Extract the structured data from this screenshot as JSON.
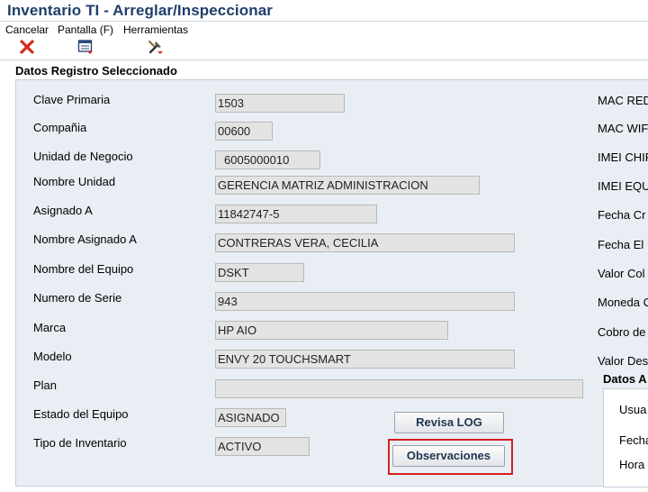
{
  "window": {
    "title": "Inventario TI - Arreglar/Inspeccionar"
  },
  "toolbar": {
    "cancel_label": "Cancelar",
    "screen_label": "Pantalla (F)",
    "tools_label": "Herramientas"
  },
  "section": {
    "title": "Datos Registro Seleccionado"
  },
  "fields": {
    "clave_primaria": {
      "label": "Clave Primaria",
      "value": "1503"
    },
    "compania": {
      "label": "Compañia",
      "value": "00600"
    },
    "unidad_negocio": {
      "label": "Unidad de Negocio",
      "value": "6005000010"
    },
    "nombre_unidad": {
      "label": "Nombre Unidad",
      "value": "GERENCIA MATRIZ ADMINISTRACION"
    },
    "asignado_a": {
      "label": "Asignado A",
      "value": "11842747-5"
    },
    "nombre_asignado": {
      "label": "Nombre Asignado A",
      "value": "CONTRERAS VERA, CECILIA"
    },
    "nombre_equipo": {
      "label": "Nombre del Equipo",
      "value": "DSKT"
    },
    "numero_serie": {
      "label": "Numero de Serie",
      "value": "943"
    },
    "marca": {
      "label": "Marca",
      "value": "HP AIO"
    },
    "modelo": {
      "label": "Modelo",
      "value": "ENVY 20 TOUCHSMART"
    },
    "plan": {
      "label": "Plan",
      "value": ""
    },
    "estado_equipo": {
      "label": "Estado del Equipo",
      "value": "ASIGNADO"
    },
    "tipo_inventario": {
      "label": "Tipo de Inventario",
      "value": "ACTIVO"
    }
  },
  "buttons": {
    "revisa_log": "Revisa LOG",
    "observaciones": "Observaciones"
  },
  "right_labels": {
    "mac_red": "MAC RED",
    "mac_wifi": "MAC WIFI",
    "imei_chip": "IMEI CHIP",
    "imei_equipo": "IMEI EQU",
    "fecha_cr": "Fecha Cr",
    "fecha_el": "Fecha El",
    "valor_col": "Valor Col",
    "moneda": "Moneda C",
    "cobro": "Cobro de",
    "valor_des": "Valor Des"
  },
  "subsection": {
    "title": "Datos A",
    "usuario": "Usua",
    "fecha": "Fecha",
    "hora": "Hora"
  },
  "colors": {
    "title": "#1f3f6b",
    "panel": "#e8eef4",
    "highlight": "#d62020"
  }
}
